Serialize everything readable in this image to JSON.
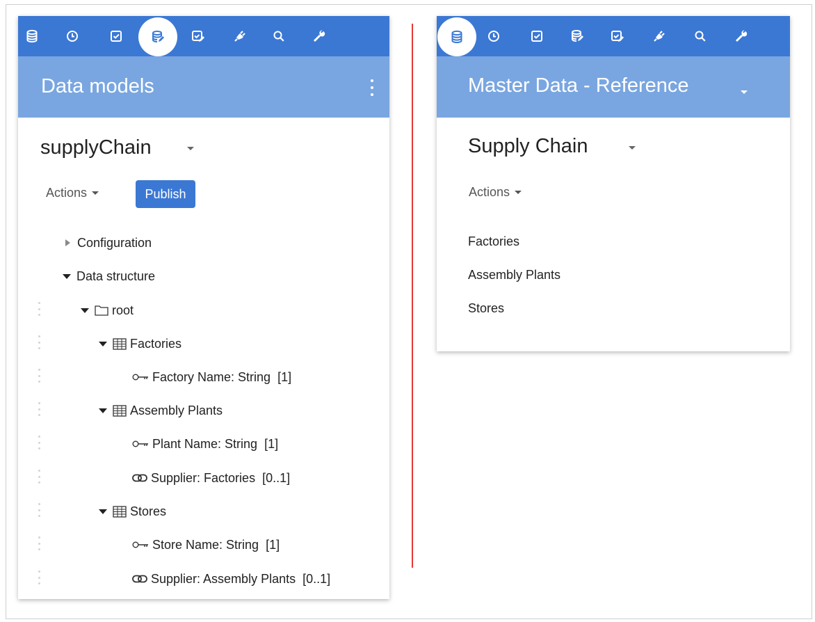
{
  "left": {
    "header_title": "Data models",
    "model_name": "supplyChain",
    "actions_label": "Actions",
    "publish_label": "Publish",
    "tree": {
      "configuration": "Configuration",
      "data_structure": "Data structure",
      "root": "root",
      "factories": "Factories",
      "factory_name": "Factory Name: String",
      "factory_name_card": "[1]",
      "assembly_plants": "Assembly Plants",
      "plant_name": "Plant Name: String",
      "plant_name_card": "[1]",
      "supplier_factories": "Supplier: Factories",
      "supplier_factories_card": "[0..1]",
      "stores": "Stores",
      "store_name": "Store Name: String",
      "store_name_card": "[1]",
      "supplier_assembly": "Supplier: Assembly Plants",
      "supplier_assembly_card": "[0..1]"
    }
  },
  "right": {
    "header_title": "Master Data - Reference",
    "model_name": "Supply Chain",
    "actions_label": "Actions",
    "items": [
      "Factories",
      "Assembly Plants",
      "Stores"
    ]
  },
  "toolbar_icons": [
    "database-icon",
    "history-icon",
    "tasks-icon",
    "data-model-icon",
    "workflow-icon",
    "plugin-icon",
    "search-icon",
    "admin-wrench-icon"
  ],
  "colors": {
    "toolbar": "#3b78d4",
    "header": "#79a6e0",
    "publish": "#3b78d4",
    "divider": "#e53935"
  }
}
